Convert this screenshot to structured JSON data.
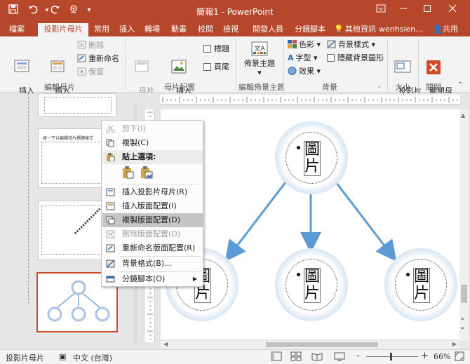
{
  "window": {
    "title": "簡報1 - PowerPoint",
    "brand_color": "#b7472a",
    "controls": [
      "ribbon-display-icon",
      "minimize-icon",
      "maximize-icon",
      "close-icon"
    ]
  },
  "quick_access": [
    "save-icon",
    "undo-icon",
    "redo-icon",
    "touch-mode-icon"
  ],
  "tabs": [
    "檔案",
    "投影片母片",
    "常用",
    "插入",
    "轉場",
    "動畫",
    "校閱",
    "檢視",
    "開發人員",
    "分鏡腳本"
  ],
  "active_tab": "投影片母片",
  "tell_me": "其他資訊",
  "user": "wenhsien...",
  "share_label": "共用",
  "ribbon": {
    "groups": {
      "edit_master": "編輯母片",
      "master_layout": "母片配置",
      "edit_theme": "編輯佈景主題",
      "background": "背景",
      "size": "大小",
      "close": "關閉"
    },
    "insert_slide_master": "插入\n投影片母片",
    "insert_layout": "插入\n版面配置",
    "delete": "刪除",
    "rename": "重新命名",
    "preserve": "保留",
    "master_layout_btn": "母片\n版面配置",
    "insert_placeholder": "插入\n版面配置區",
    "title_cb": "標題",
    "footer_cb": "頁尾",
    "themes": "佈景主題",
    "colors": "色彩",
    "fonts": "字型",
    "effects": "效果",
    "bg_styles": "背景樣式",
    "hide_bg": "隱藏背景圖形",
    "slide_size": "投影片\n大小",
    "close_master": "關閉母\n片檢視"
  },
  "context_menu": {
    "cut": "剪下(I)",
    "copy": "複製(C)",
    "paste_header": "貼上選項:",
    "insert_master": "插入投影片母片(R)",
    "insert_layout": "插入版面配置(I)",
    "duplicate_layout": "複製版面配置(D)",
    "delete_layout": "刪除版面配置(D)",
    "rename_layout": "重新命名版面配置(R)",
    "format_bg": "背景格式(B)...",
    "section": "分鏡腳本(O)"
  },
  "thumbnails": {
    "thumb2_caption": "按一下以編輯母片標題樣式"
  },
  "slide": {
    "placeholder_char_top": "圖",
    "placeholder_char_bottom": "片",
    "node_color": "#a5c4e6",
    "arrow_color": "#5b9bd5"
  },
  "status": {
    "view": "投影片母片",
    "language": "中文 (台灣)",
    "zoom": "66%",
    "zoom_minus": "-",
    "zoom_plus": "+"
  }
}
